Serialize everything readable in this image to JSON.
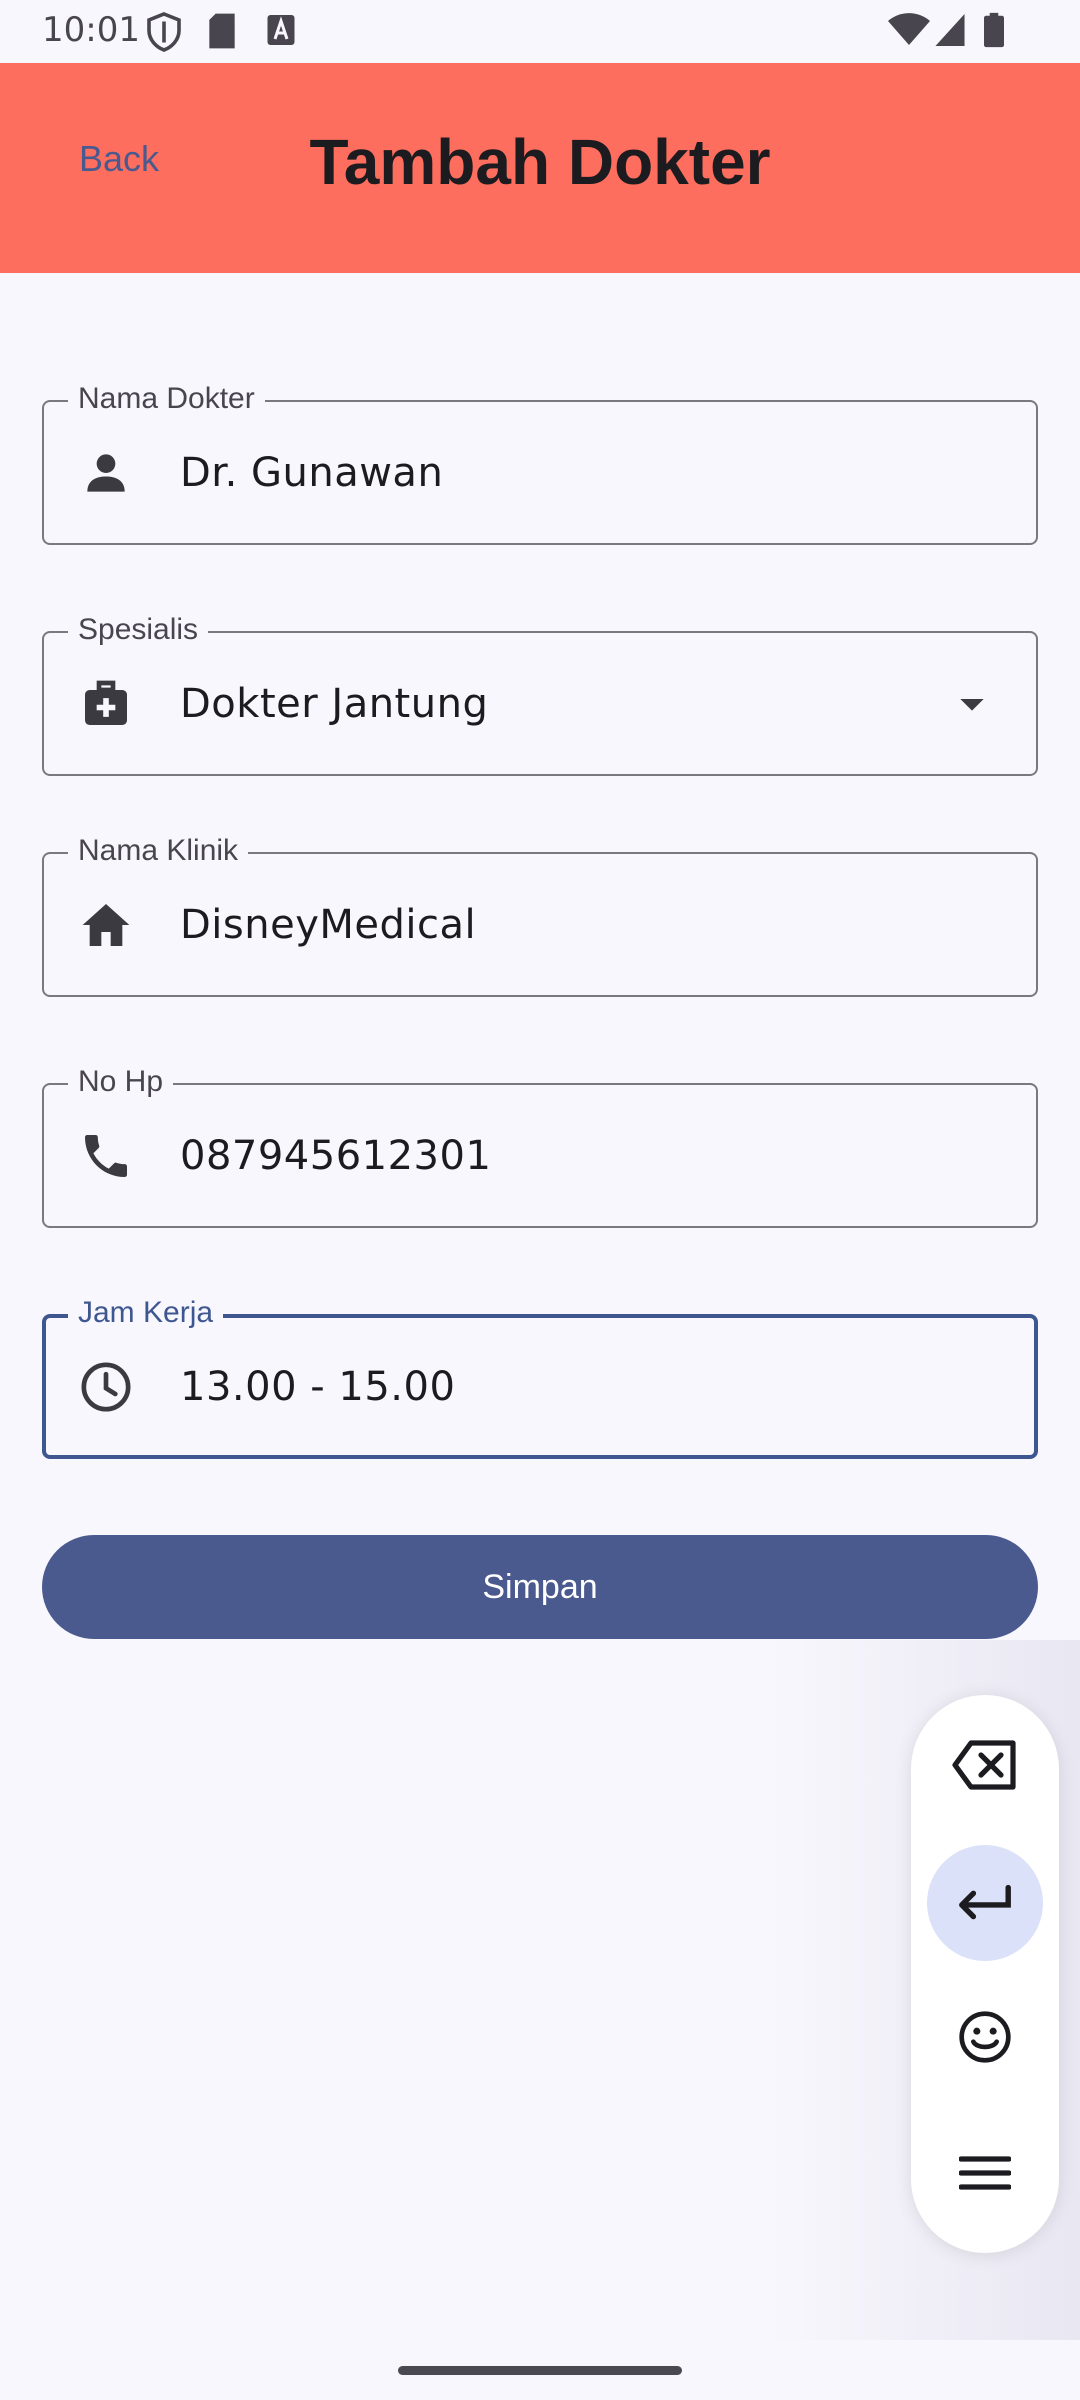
{
  "status_bar": {
    "time": "10:01"
  },
  "app_bar": {
    "back_label": "Back",
    "title": "Tambah Dokter"
  },
  "form": {
    "nama_dokter": {
      "label": "Nama Dokter",
      "value": "Dr. Gunawan",
      "icon": "person-icon"
    },
    "spesialis": {
      "label": "Spesialis",
      "value": "Dokter Jantung",
      "icon": "medical-bag-icon"
    },
    "nama_klinik": {
      "label": "Nama Klinik",
      "value": "DisneyMedical",
      "icon": "home-icon"
    },
    "no_hp": {
      "label": "No Hp",
      "value": "087945612301",
      "icon": "phone-icon"
    },
    "jam_kerja": {
      "label": "Jam Kerja",
      "value": "13.00 - 15.00",
      "icon": "clock-icon"
    }
  },
  "save_label": "Simpan",
  "keyboard_toolbar": [
    "backspace-icon",
    "enter-icon",
    "emoji-icon",
    "menu-icon"
  ],
  "colors": {
    "app_bar": "#FE6E5E",
    "primary": "#4A5A8F",
    "background": "#F8F7FD",
    "focused_outline": "#3F5790"
  }
}
